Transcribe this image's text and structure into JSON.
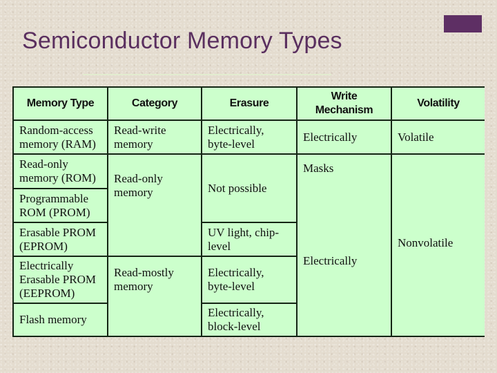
{
  "slide": {
    "title": "Semiconductor Memory Types",
    "accent_color": "#5e2f64",
    "table_fill": "#ccffcc"
  },
  "table": {
    "headers": [
      "Memory Type",
      "Category",
      "Erasure",
      "Write Mechanism",
      "Volatility"
    ],
    "header_write_line1": "Write",
    "header_write_line2": "Mechanism",
    "memory_types": [
      "Random-access memory (RAM)",
      "Read-only memory (ROM)",
      "Programmable ROM (PROM)",
      "Erasable PROM (EPROM)",
      "Electrically Erasable PROM (EEPROM)",
      "Flash memory"
    ],
    "categories": [
      {
        "label": "Read-write memory",
        "applies_to": [
          "RAM"
        ]
      },
      {
        "label": "Read-only memory",
        "applies_to": [
          "ROM",
          "PROM",
          "EPROM"
        ]
      },
      {
        "label": "Read-mostly memory",
        "applies_to": [
          "EEPROM",
          "Flash memory"
        ]
      }
    ],
    "erasure": [
      {
        "label": "Electrically, byte-level",
        "applies_to": [
          "RAM"
        ]
      },
      {
        "label": "Not possible",
        "applies_to": [
          "ROM",
          "PROM"
        ]
      },
      {
        "label": "UV light, chip-level",
        "applies_to": [
          "EPROM"
        ]
      },
      {
        "label": "Electrically, byte-level",
        "applies_to": [
          "EEPROM"
        ]
      },
      {
        "label": "Electrically, block-level",
        "applies_to": [
          "Flash memory"
        ]
      }
    ],
    "write_mechanism": [
      {
        "label": "Electrically",
        "applies_to": [
          "RAM"
        ]
      },
      {
        "label": "Masks",
        "applies_to": [
          "ROM"
        ]
      },
      {
        "label": "Electrically",
        "applies_to": [
          "PROM",
          "EPROM",
          "EEPROM",
          "Flash memory"
        ]
      }
    ],
    "volatility": [
      {
        "label": "Volatile",
        "applies_to": [
          "RAM"
        ]
      },
      {
        "label": "Nonvolatile",
        "applies_to": [
          "ROM",
          "PROM",
          "EPROM",
          "EEPROM",
          "Flash memory"
        ]
      }
    ]
  }
}
